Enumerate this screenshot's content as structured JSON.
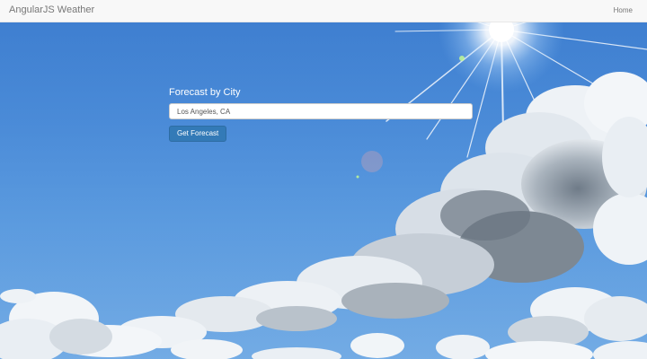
{
  "navbar": {
    "brand": "AngularJS Weather",
    "home_label": "Home"
  },
  "form": {
    "label": "Forecast by City",
    "city_value": "Los Angeles, CA",
    "button_label": "Get Forecast"
  },
  "colors": {
    "navbar_bg": "#f8f8f8",
    "sky_blue": "#4a8bd8",
    "button_primary": "#337ab7"
  }
}
